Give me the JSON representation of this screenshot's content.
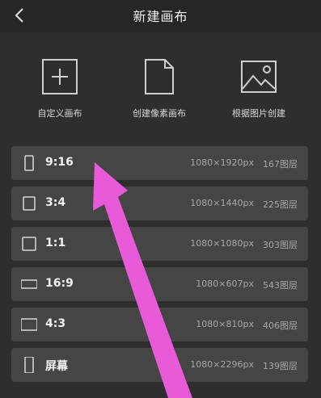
{
  "header": {
    "title": "新建画布"
  },
  "options": [
    {
      "label": "自定义画布",
      "icon": "plus-square-icon"
    },
    {
      "label": "创建像素画布",
      "icon": "document-icon"
    },
    {
      "label": "根据图片创建",
      "icon": "image-icon"
    }
  ],
  "presets": [
    {
      "ratio": "9:16",
      "size": "1080×1920px",
      "layers": "167图层",
      "icon": "portrait-rect-icon"
    },
    {
      "ratio": "3:4",
      "size": "1080×1440px",
      "layers": "225图层",
      "icon": "portrait-rect-icon"
    },
    {
      "ratio": "1:1",
      "size": "1080×1080px",
      "layers": "303图层",
      "icon": "square-icon"
    },
    {
      "ratio": "16:9",
      "size": "1080×607px",
      "layers": "543图层",
      "icon": "landscape-rect-icon"
    },
    {
      "ratio": "4:3",
      "size": "1080×810px",
      "layers": "406图层",
      "icon": "landscape-rect-icon"
    },
    {
      "ratio": "屏幕",
      "size": "1080×2296px",
      "layers": "139图层",
      "icon": "phone-screen-icon"
    }
  ],
  "annotation": {
    "color": "#e85ad8"
  }
}
